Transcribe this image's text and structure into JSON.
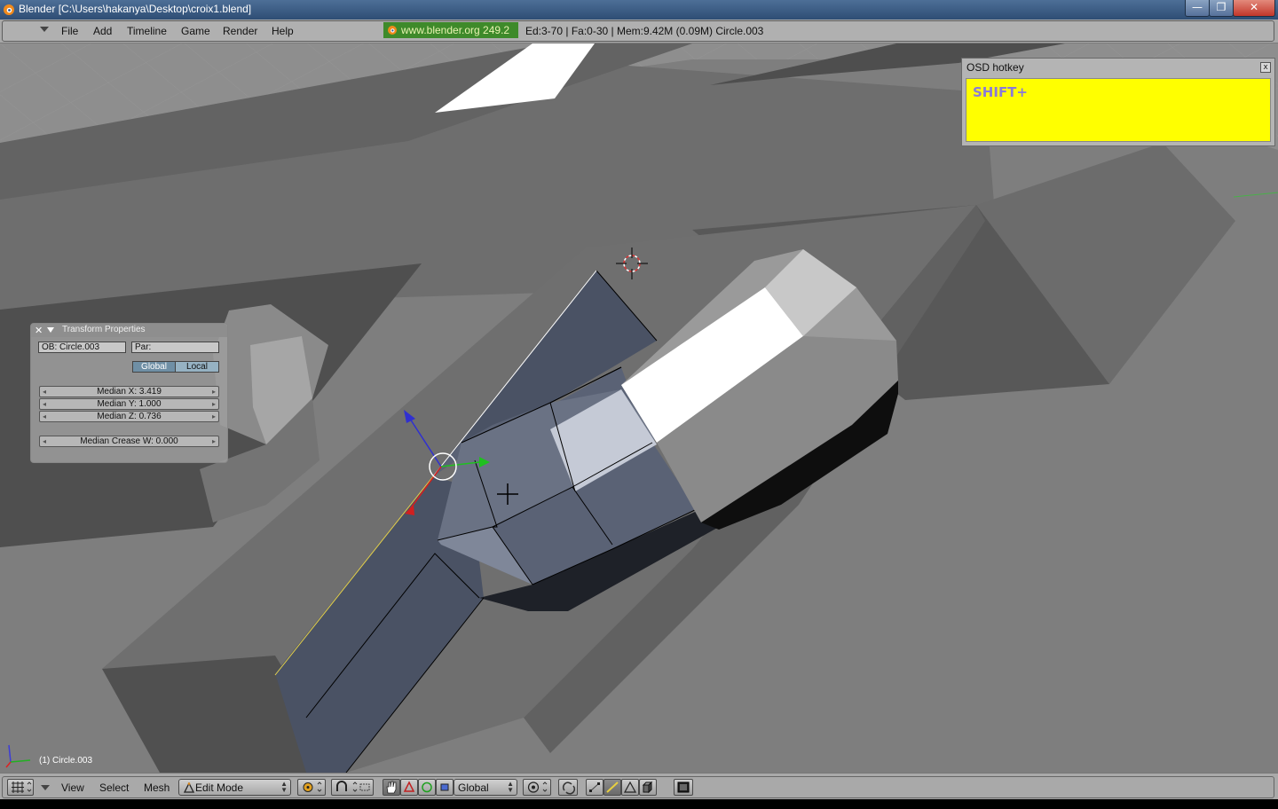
{
  "window": {
    "title": "Blender [C:\\Users\\hakanya\\Desktop\\croix1.blend]",
    "minimize_symbol": "—",
    "maximize_symbol": "❐",
    "close_symbol": "✕"
  },
  "menubar": {
    "items": [
      "File",
      "Add",
      "Timeline",
      "Game",
      "Render",
      "Help"
    ],
    "link": "www.blender.org 249.2",
    "stats": "Ed:3-70 | Fa:0-30 | Mem:9.42M (0.09M) Circle.003"
  },
  "osd": {
    "title": "OSD hotkey",
    "close_symbol": "x",
    "text": "SHIFT+"
  },
  "transform_panel": {
    "close_symbol": "✕",
    "title": "Transform Properties",
    "ob_field": "OB: Circle.003",
    "par_field": "Par:",
    "global_label": "Global",
    "local_label": "Local",
    "median_x": "Median X: 3.419",
    "median_y": "Median Y: 1.000",
    "median_z": "Median Z: 0.736",
    "median_crease": "Median Crease W: 0.000"
  },
  "viewport": {
    "object_label": "(1) Circle.003"
  },
  "footer": {
    "view_label": "View",
    "select_label": "Select",
    "mesh_label": "Mesh",
    "mode_value": "Edit Mode",
    "orientation_value": "Global"
  },
  "colors": {
    "osd_background": "#ffff00",
    "osd_text": "#8a7ad8",
    "link_background": "#3e8a2a",
    "selection_face": "#4a5264"
  }
}
